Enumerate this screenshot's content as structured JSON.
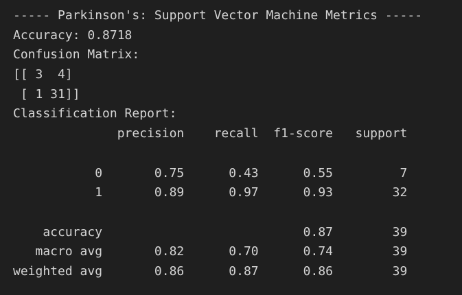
{
  "output": {
    "lines": [
      "----- Parkinson's: Support Vector Machine Metrics -----",
      "Accuracy: 0.8718",
      "Confusion Matrix:",
      "[[ 3  4]",
      " [ 1 31]]",
      "Classification Report:",
      "              precision    recall  f1-score   support",
      "",
      "           0       0.75      0.43      0.55         7",
      "           1       0.89      0.97      0.93        32",
      "",
      "    accuracy                           0.87        39",
      "   macro avg       0.82      0.70      0.74        39",
      "weighted avg       0.86      0.87      0.86        39"
    ]
  }
}
